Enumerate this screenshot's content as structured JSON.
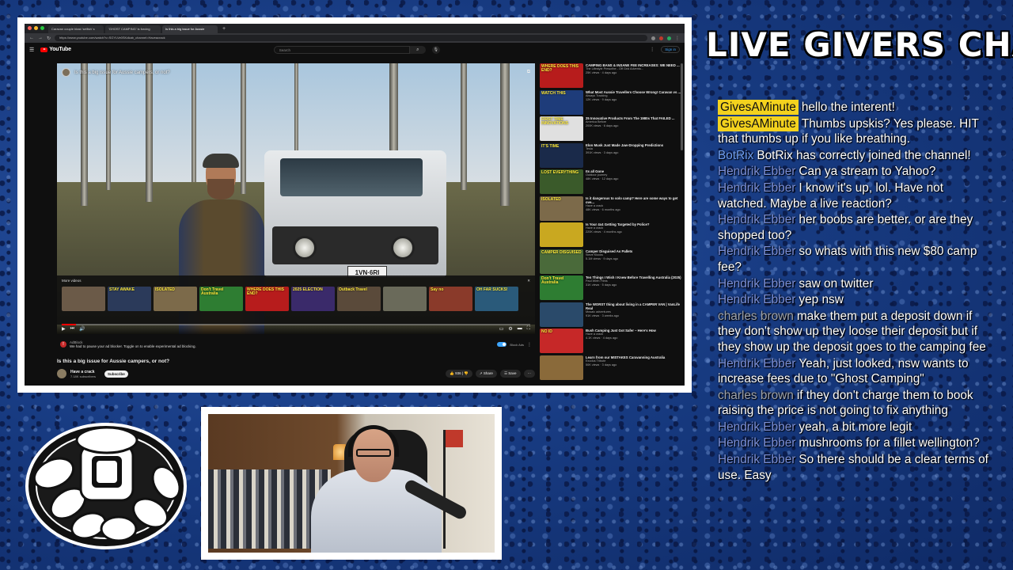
{
  "browser": {
    "tabs": [
      {
        "label": "Caravan couple blast 'selfish' s",
        "active": false
      },
      {
        "label": "'GHOST CAMPING' is forcing",
        "active": false
      },
      {
        "label": "Is this a big issue for Aussie",
        "active": true
      }
    ],
    "new_tab": "+",
    "url": "https://www.youtube.com/watch?v=SGYLVe0SKdkab_channel=Haveacrack"
  },
  "youtube": {
    "logo_text": "YouTube",
    "search_placeholder": "Search",
    "sign_in": "Sign in",
    "player": {
      "title": "Is this a big issue for Aussie campers, or not?",
      "plate": "1VN·6RI",
      "more_videos_label": "More videos",
      "more_videos": [
        {
          "text": "",
          "bg": "#6b5a48"
        },
        {
          "text": "STAY AWAKE",
          "bg": "#2b3a5a"
        },
        {
          "text": "ISOLATED",
          "bg": "#7c6a4a"
        },
        {
          "text": "Don't Travel Australia",
          "bg": "#2e7d32"
        },
        {
          "text": "WHERE DOES THIS END?",
          "bg": "#b71c1c"
        },
        {
          "text": "2025 ELECTION",
          "bg": "#3a2a6a"
        },
        {
          "text": "Outback Travel",
          "bg": "#5a4a3a"
        },
        {
          "text": "",
          "bg": "#6a6a5a"
        },
        {
          "text": "Say no",
          "bg": "#8a3a2a"
        },
        {
          "text": "OH FAR SUCKS!",
          "bg": "#2a5a7a"
        }
      ],
      "progress": 0.03
    },
    "ad": {
      "name": "AdBlock",
      "text": "We had to pause your ad blocker. Toggle on to enable experimental ad blocking.",
      "toggle_label": "Block Ads"
    },
    "video": {
      "title": "Is this a big issue for Aussie campers, or not?",
      "channel": "Have a crack",
      "subscribers": "7.18K subscribers",
      "subscribe": "Subscribe",
      "likes": "936",
      "share": "Share",
      "save": "Save",
      "more": "···"
    },
    "related": [
      {
        "thumb": "WHERE DOES THIS END?",
        "bg": "#b71c1c",
        "title": "CAMPING BANS & INSANE FEE INCREASES: WE NEED ...",
        "channel": "The Lifestyle Prescribe - Off Grid Adventu...",
        "views": "25K views · 4 days ago"
      },
      {
        "thumb": "WATCH THIS",
        "bg": "#1e3c7a",
        "title": "What Most Aussie Travellers Choose Wrong! Caravan vs ...",
        "channel": "Always Tracking",
        "views": "12K views · 9 days ago"
      },
      {
        "thumb": "FIRST TIME INNOVATIONS",
        "bg": "#e0e0e0",
        "title": "25 Innovative Products From The 1980s That FAILED ...",
        "channel": "America Before",
        "views": "200K views · 6 days ago"
      },
      {
        "thumb": "IT'S TIME",
        "bg": "#1a2a4a",
        "title": "Elon Musk Just Made Jaw-Dropping Predictions",
        "channel": "Tesla",
        "views": "391K views · 3 days ago"
      },
      {
        "thumb": "LOST EVERYTHING",
        "bg": "#3a5a2a",
        "title": "Its all Gone",
        "channel": "Outdoor journey",
        "views": "48K views · 12 days ago"
      },
      {
        "thumb": "ISOLATED",
        "bg": "#7c6a4a",
        "title": "Is it dangerous to solo camp? Here are some ways to get ove...",
        "channel": "Have a crack",
        "views": "48K views · 6 months ago"
      },
      {
        "thumb": "",
        "bg": "#c9a820",
        "title": "Is Your 4x4 Getting Targeted by Police?",
        "channel": "Have a crack",
        "views": "220K views · 4 months ago"
      },
      {
        "thumb": "CAMPER DISGUISED",
        "bg": "#4a6a3a",
        "title": "Camper Disguised As Pallets",
        "channel": "Steve Klocks",
        "views": "5.1M views · 9 days ago"
      },
      {
        "thumb": "Don't Travel Australia",
        "bg": "#2e7d32",
        "title": "Ten Things I Wish I Knew Before Travelling Australia (2025)",
        "channel": "Paul Wirth Films",
        "views": "31K views · 5 days ago"
      },
      {
        "thumb": "",
        "bg": "#2a4a6a",
        "title": "The WORST thing about living in a CAMPER VAN | VanLife Real",
        "channel": "Mosaic adventures",
        "views": "91K views · 3 weeks ago"
      },
      {
        "thumb": "NO ID",
        "bg": "#c62828",
        "title": "Bush Camping Just Got Safer – Here's How",
        "channel": "Have a crack",
        "views": "4.1K views · 4 days ago"
      },
      {
        "thumb": "",
        "bg": "#8a6a3a",
        "title": "Learn from our MISTAKES Caravanning Australia",
        "channel": "Exodus Tribute",
        "views": "50K views · 3 days ago"
      }
    ]
  },
  "chat": {
    "title": "LIVE GIVERS CHAT",
    "messages": [
      {
        "user": "GivesAMinute",
        "type": "hl",
        "text": "hello the interent!"
      },
      {
        "user": "GivesAMinute",
        "type": "hl",
        "text": "Thumbs upskis? Yes please. HIT that thumbs up if you like breathing."
      },
      {
        "user": "BotRix",
        "type": "botrix",
        "text": "BotRix has correctly joined the channel!"
      },
      {
        "user": "Hendrik Ebber",
        "type": "hendrik",
        "text": "Can ya stream to Yahoo?"
      },
      {
        "user": "Hendrik Ebber",
        "type": "hendrik",
        "text": "I know it's up, lol. Have not watched. Maybe a live reaction?"
      },
      {
        "user": "Hendrik Ebber",
        "type": "hendrik",
        "text": "her boobs are better. or are they shopped too?"
      },
      {
        "user": "Hendrik Ebber",
        "type": "hendrik",
        "text": "so whats with this new $80 camp fee?"
      },
      {
        "user": "Hendrik Ebber",
        "type": "hendrik",
        "text": "saw on twitter"
      },
      {
        "user": "Hendrik Ebber",
        "type": "hendrik",
        "text": "yep nsw"
      },
      {
        "user": "charles brown",
        "type": "charles",
        "text": "make them put a deposit down if they don't show up they loose their deposit but if they show up the deposit goes to the camping fee"
      },
      {
        "user": "Hendrik Ebber",
        "type": "hendrik",
        "text": "Yeah, just looked, nsw wants to increase fees due to \"Ghost Camping\""
      },
      {
        "user": "charles brown",
        "type": "charles",
        "text": "if they don't charge them to book raising the price is not going to fix anything"
      },
      {
        "user": "Hendrik Ebber",
        "type": "hendrik",
        "text": "yeah, a bit more legit"
      },
      {
        "user": "Hendrik Ebber",
        "type": "hendrik",
        "text": "mushrooms for a fillet wellington?"
      },
      {
        "user": "Hendrik Ebber",
        "type": "hendrik",
        "text": "So there should be a clear terms of use. Easy"
      }
    ]
  },
  "colors": {
    "background": "#1c3f8a",
    "highlight_user": "#f3d21e",
    "botrix": "#6f9ef0",
    "hendrik": "#7b8fd8",
    "charles": "#9fa4ad",
    "youtube_red": "#ff0000"
  }
}
